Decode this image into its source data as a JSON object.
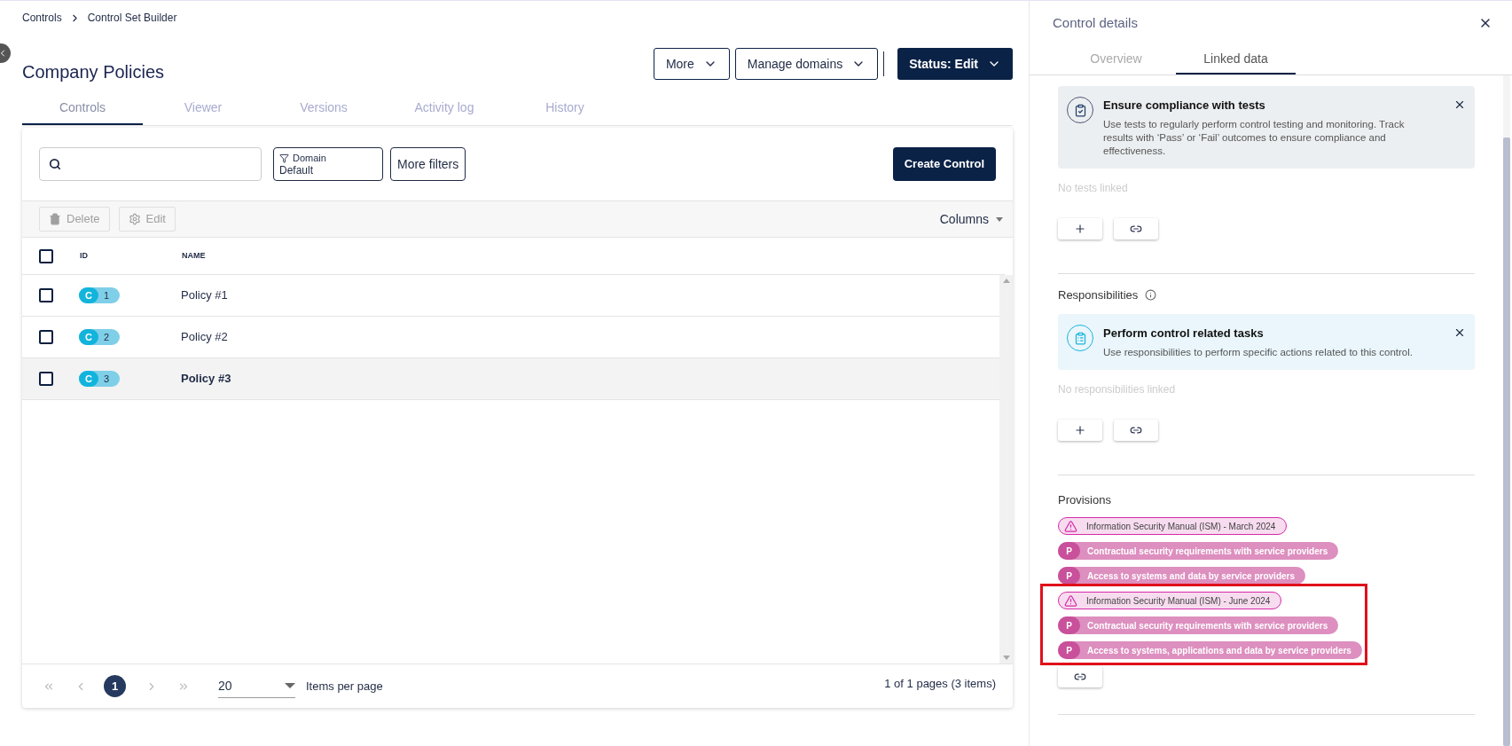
{
  "breadcrumb": [
    "Controls",
    "Control Set Builder"
  ],
  "page_title": "Company Policies",
  "header_buttons": [
    {
      "label": "More",
      "kind": "outline"
    },
    {
      "label": "Manage domains",
      "kind": "outline"
    },
    {
      "label": "Status: Edit",
      "kind": "solid"
    }
  ],
  "tabs": [
    {
      "label": "Controls",
      "selected": true
    },
    {
      "label": "Viewer",
      "selected": false
    },
    {
      "label": "Versions",
      "selected": false
    },
    {
      "label": "Activity log",
      "selected": false
    },
    {
      "label": "History",
      "selected": false
    }
  ],
  "filters": {
    "domain_label": "Domain",
    "domain_value": "Default",
    "more_filters": "More filters",
    "create": "Create Control"
  },
  "actions": [
    {
      "label": "Delete",
      "kind": "delete",
      "disabled": true
    },
    {
      "label": "Edit",
      "kind": "edit",
      "disabled": true
    }
  ],
  "columns_menu": "Columns",
  "table": {
    "columns": [
      "ID",
      "NAME"
    ],
    "header_checked": false,
    "rows": [
      {
        "badge": "C",
        "id": "1",
        "name": "Policy #1",
        "checked": false,
        "selected": false
      },
      {
        "badge": "C",
        "id": "2",
        "name": "Policy #2",
        "checked": false,
        "selected": false
      },
      {
        "badge": "C",
        "id": "3",
        "name": "Policy #3",
        "checked": false,
        "selected": true
      }
    ]
  },
  "pagination": {
    "pages": [
      {
        "label": "1",
        "selected": true
      }
    ],
    "per_page": "20",
    "per_page_label": "Items per page",
    "summary": "1 of 1 pages (3 items)"
  },
  "panel": {
    "title": "Control details",
    "tabs": [
      {
        "label": "Overview",
        "selected": false
      },
      {
        "label": "Linked data",
        "selected": true
      }
    ],
    "sections": [
      {
        "hint": {
          "kind": "test",
          "title": "Ensure compliance with tests",
          "text": "Use tests to regularly perform control testing and monitoring. Track results with ‘Pass’ or ‘Fail’ outcomes to ensure compliance and effectiveness."
        },
        "empty": "No tests linked"
      },
      {
        "title": "Responsibilities",
        "hint": {
          "kind": "task",
          "title": "Perform control related tasks",
          "text": "Use responsibilities to perform specific actions related to this control."
        },
        "empty": "No responsibilities linked"
      }
    ],
    "provisions": {
      "title": "Provisions",
      "items": [
        {
          "label": "Information Security Manual (ISM) - March 2024",
          "highlighted": false,
          "children": [
            {
              "badge": "P",
              "label": "Contractual security requirements with service providers"
            },
            {
              "badge": "P",
              "label": "Access to systems and data by service providers"
            }
          ]
        },
        {
          "label": "Information Security Manual (ISM) - June 2024",
          "highlighted": true,
          "children": [
            {
              "badge": "P",
              "label": "Contractual security requirements with service providers"
            },
            {
              "badge": "P",
              "label": "Access to systems, applications and data by service providers"
            }
          ]
        }
      ]
    }
  }
}
